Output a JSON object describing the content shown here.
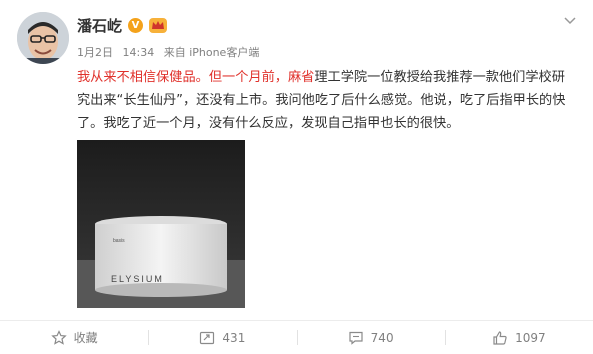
{
  "user": {
    "name": "潘石屹",
    "verified_badge": "V"
  },
  "meta": {
    "date": "1月2日",
    "time": "14:34",
    "source": "来自 iPhone客户端"
  },
  "post": {
    "seg1": "我从来不相信保健品。但一个月前，",
    "seg2": "麻省",
    "seg3": "理工学院一位教授给我推荐一款他们学校研究出来“长生仙丹”，还没有上市。我问他吃了后什么感觉。他说，吃了后指甲长的快了。我吃了近一个月，没有什么反应，发现自己指甲也长的很快。",
    "highlight_color": "#e0322c"
  },
  "photo": {
    "product_brand": "ELYSIUM",
    "jar_label": "basis"
  },
  "actions": {
    "favorite": {
      "label": "收藏",
      "icon": "star-icon"
    },
    "repost": {
      "count": "431",
      "icon": "repost-icon"
    },
    "comment": {
      "count": "740",
      "icon": "comment-icon"
    },
    "like": {
      "count": "1097",
      "icon": "thumbs-up-icon"
    }
  }
}
